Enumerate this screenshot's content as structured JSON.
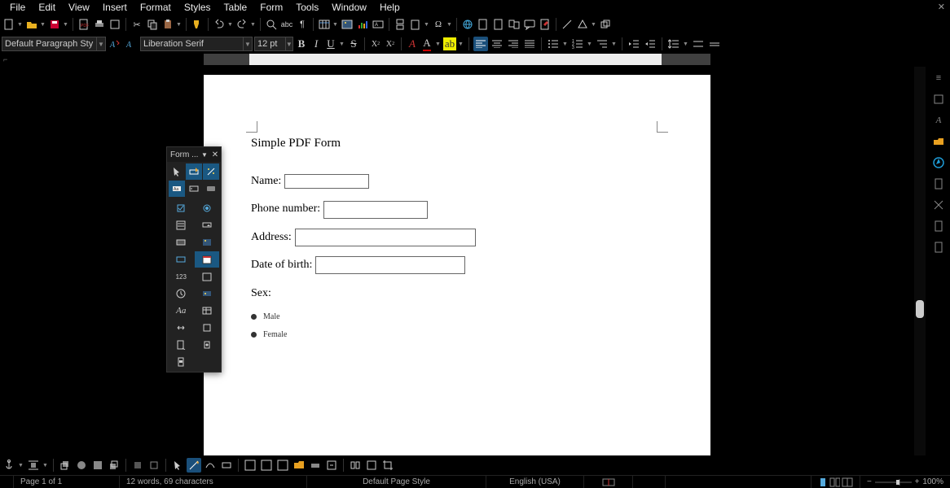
{
  "menus": [
    "File",
    "Edit",
    "View",
    "Insert",
    "Format",
    "Styles",
    "Table",
    "Form",
    "Tools",
    "Window",
    "Help"
  ],
  "paragraphStyle": "Default Paragraph Style",
  "fontName": "Liberation Serif",
  "fontSize": "12 pt",
  "doc": {
    "title": "Simple PDF Form",
    "nameLabel": "Name:",
    "phoneLabel": "Phone number:",
    "addressLabel": "Address:",
    "dobLabel": "Date of birth:",
    "sexLabel": "Sex:",
    "maleLabel": "Male",
    "femaleLabel": "Female"
  },
  "palette": {
    "title": "Form ..."
  },
  "status": {
    "page": "Page 1 of 1",
    "words": "12 words, 69 characters",
    "pageStyle": "Default Page Style",
    "lang": "English (USA)",
    "zoom": "100%"
  },
  "colors": {
    "accent": "#1a5882",
    "saveHi": "#c03"
  }
}
